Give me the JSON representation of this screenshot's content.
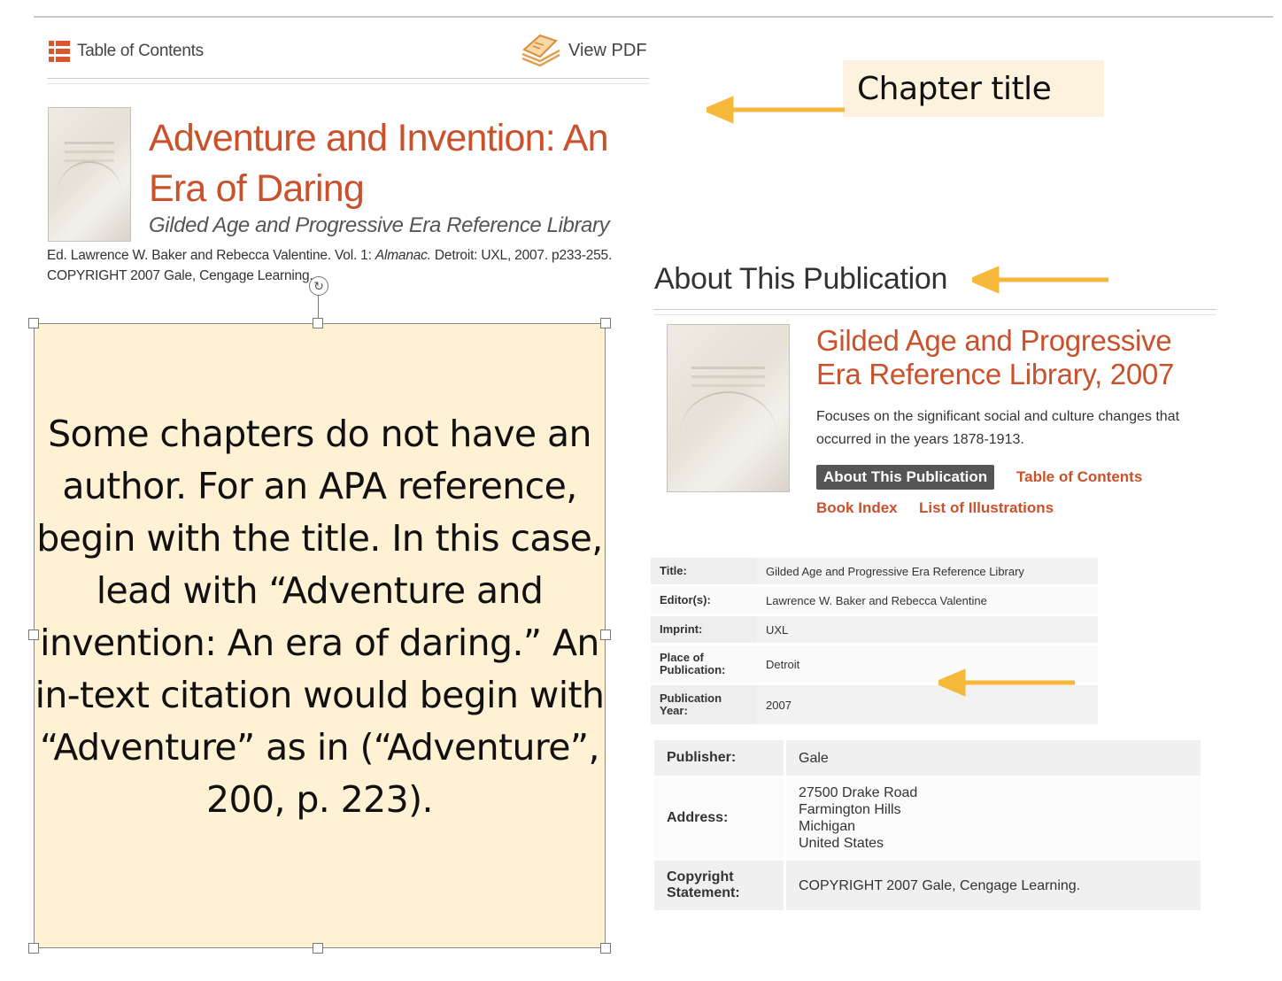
{
  "article": {
    "toc_label": "Table of Contents",
    "pdf_label": "View PDF",
    "title": "Adventure and Invention: An Era of Daring",
    "series": "Gilded Age and Progressive Era Reference Library",
    "citation_before": "Ed. Lawrence W. Baker and Rebecca Valentine. Vol. 1: ",
    "citation_italic": "Almanac.",
    "citation_after": " Detroit: UXL, 2007. p233-255.",
    "copyright": "COPYRIGHT 2007 Gale, Cengage Learning."
  },
  "callout": {
    "label": "Chapter title"
  },
  "textbox": {
    "text": "Some chapters do not have an author. For an APA reference, begin with the title.  In this case, lead with “Adventure and invention: An era of daring.”  An in-text citation would begin with “Adventure” as in (“Adventure”, 200, p. 223)."
  },
  "about": {
    "heading": "About This Publication",
    "title": "Gilded Age and Progressive Era Reference Library, 2007",
    "description": "Focuses on the significant social and culture changes that occurred in the years 1878-1913.",
    "about_button": "About This Publication",
    "toc_link": "Table of Contents",
    "book_index_link": "Book Index",
    "illustrations_link": "List of Illustrations"
  },
  "details": [
    {
      "label": "Title:",
      "value": "Gilded Age and Progressive Era Reference Library"
    },
    {
      "label": "Editor(s):",
      "value": "Lawrence W. Baker and Rebecca Valentine"
    },
    {
      "label": "Imprint:",
      "value": "UXL"
    },
    {
      "label": "Place of Publication:",
      "value": "Detroit"
    },
    {
      "label": "Publication Year:",
      "value": "2007"
    }
  ],
  "publisher": {
    "publisher_label": "Publisher:",
    "publisher_value": "Gale",
    "address_label": "Address:",
    "address_lines": [
      "27500 Drake Road",
      "Farmington Hills",
      "Michigan",
      "United States"
    ],
    "copyright_label": "Copyright Statement:",
    "copyright_value": "COPYRIGHT 2007 Gale, Cengage Learning."
  },
  "colors": {
    "accent": "#c9512c",
    "arrow": "#f5b83a",
    "note_bg": "#fef1d4",
    "label_bg": "#fdf2dd"
  },
  "icons": [
    "list-icon",
    "pdf-book-icon",
    "rotate-icon",
    "arrow-left-icon"
  ]
}
